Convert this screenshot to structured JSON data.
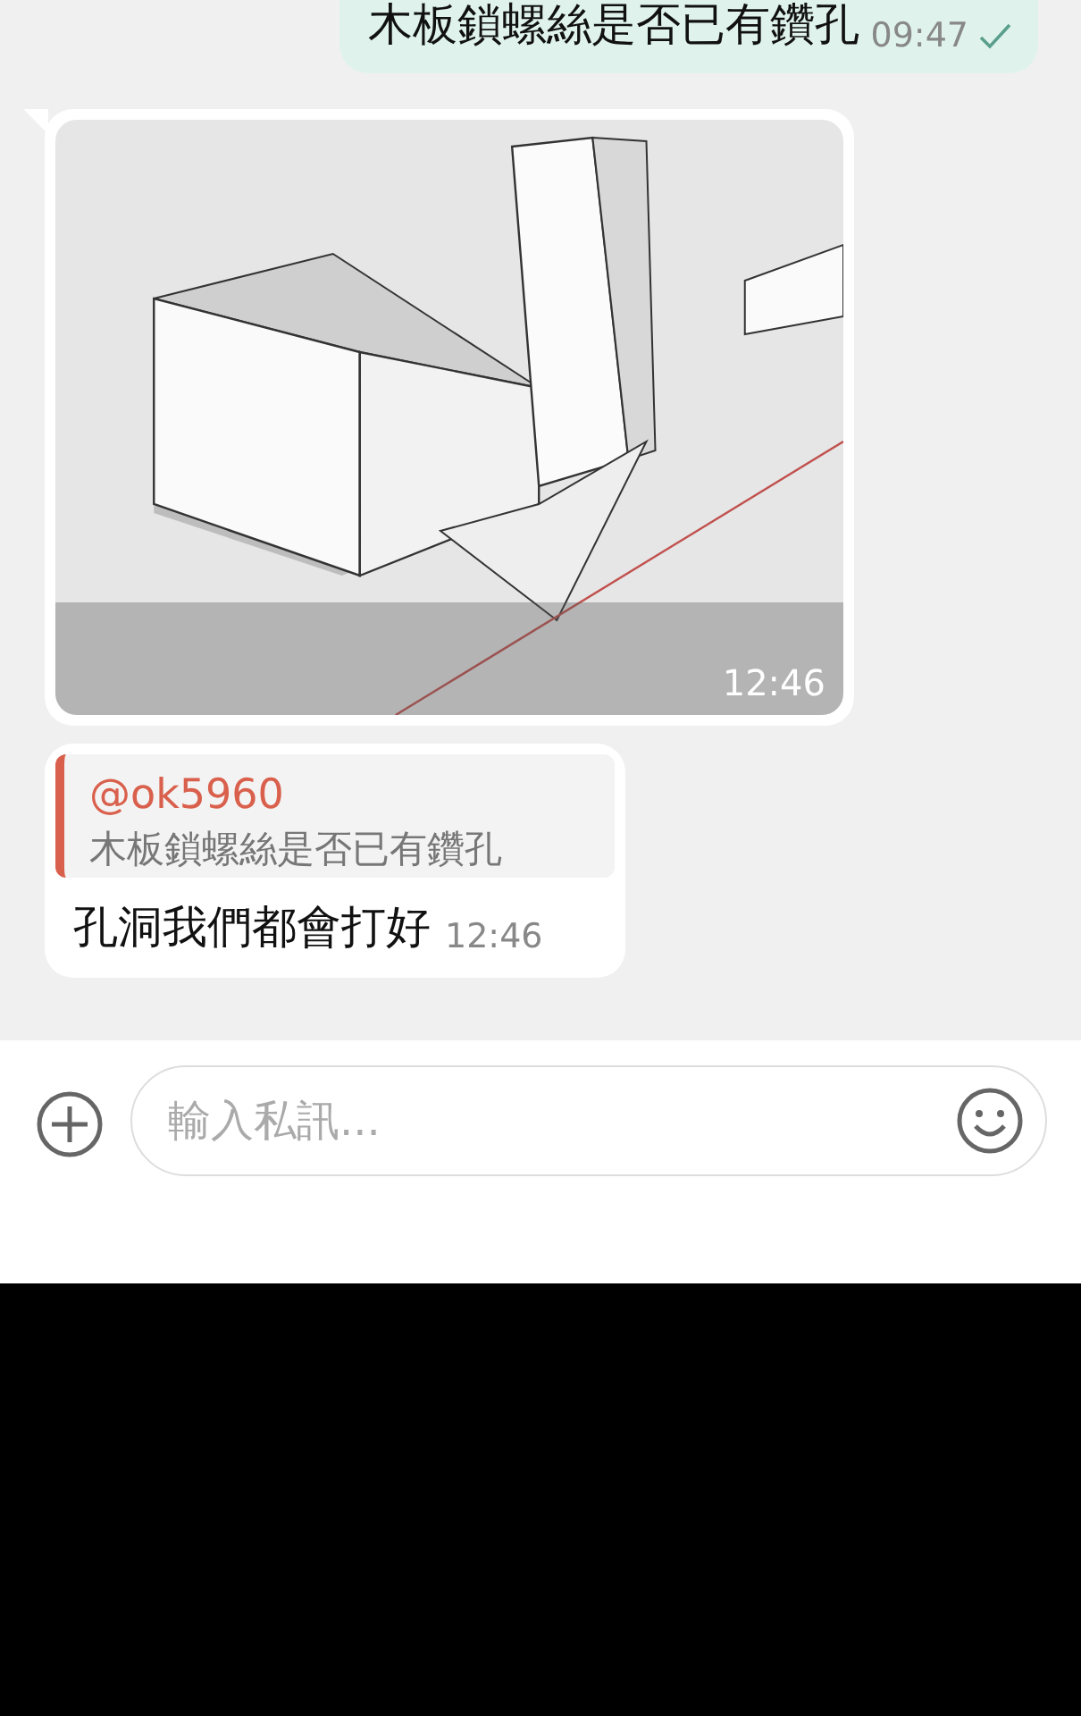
{
  "messages": [
    {
      "kind": "text",
      "outgoing": true,
      "text": "木板鎖螺絲是否已有鑽孔",
      "time": "09:47",
      "read": true
    },
    {
      "outgoing": false,
      "time": "12:46"
    },
    {
      "kind": "reply",
      "outgoing": false,
      "quote": {
        "author": "@ok5960",
        "text": "木板鎖螺絲是否已有鑽孔"
      },
      "text": "孔洞我們都會打好",
      "time": "12:46"
    }
  ],
  "composer": {
    "placeholder": "輸入私訊..."
  }
}
